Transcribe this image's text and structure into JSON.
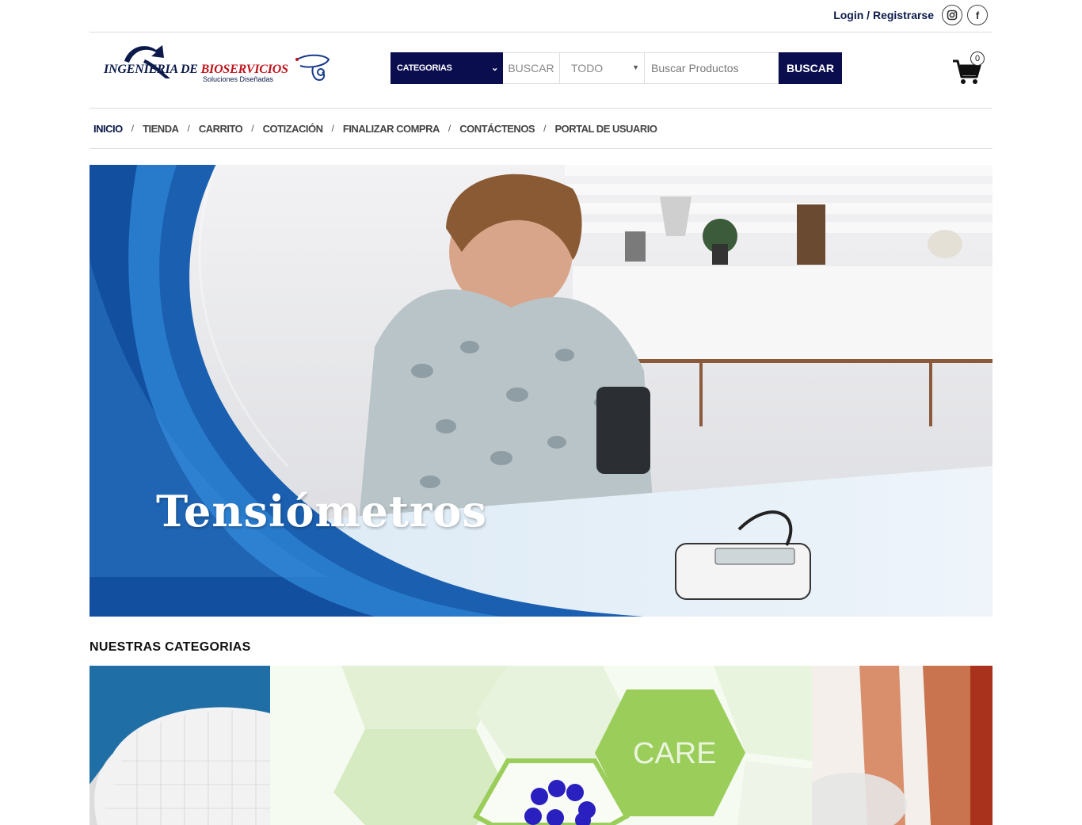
{
  "topbar": {
    "login_label": "Login / Registrarse",
    "social": [
      "instagram-icon",
      "facebook-icon"
    ],
    "facebook_glyph": "f"
  },
  "logo": {
    "line1_main": "INGENIERIA DE ",
    "line1_accent": "BIOSERVICIOS",
    "line2": "Soluciones Diseñadas"
  },
  "search": {
    "category_label": "CATEGORIAS",
    "search_label": "BUSCAR",
    "scope_value": "TODO",
    "input_placeholder": "Buscar Productos",
    "button_label": "BUSCAR"
  },
  "cart": {
    "count": "0"
  },
  "nav": {
    "items": [
      "INICIO",
      "TIENDA",
      "CARRITO",
      "COTIZACIÓN",
      "FINALIZAR COMPRA",
      "CONTÁCTENOS",
      "PORTAL DE USUARIO"
    ],
    "separator": "/"
  },
  "hero": {
    "title": "Tensiómetros"
  },
  "categories": {
    "title": "NUESTRAS CATEGORIAS",
    "tile2_text": "CARE"
  },
  "colors": {
    "brand_navy": "#0b0e4e",
    "logo_red": "#c0141c",
    "hero_blue": "#1a5fb0"
  }
}
